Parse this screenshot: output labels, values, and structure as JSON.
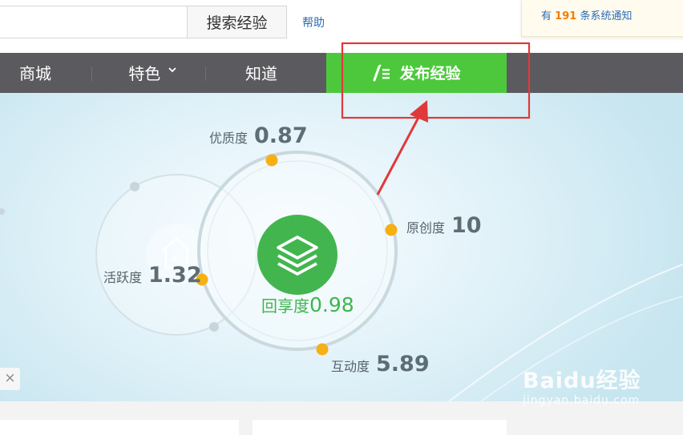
{
  "topbar": {
    "search_value": "",
    "search_button": "搜索经验",
    "help": "帮助",
    "notice_prefix": "有",
    "notice_count": "191",
    "notice_suffix": "条系统通知"
  },
  "nav": {
    "items": [
      "商城",
      "特色",
      "知道"
    ],
    "publish": "发布经验"
  },
  "metrics": {
    "quality": {
      "label": "优质度",
      "value": "0.87"
    },
    "originality": {
      "label": "原创度",
      "value": "10"
    },
    "activity": {
      "label": "活跃度",
      "value": "1.32"
    },
    "return": {
      "label": "回享度",
      "value": "0.98"
    },
    "interaction": {
      "label": "互动度",
      "value": "5.89"
    }
  },
  "close_icon": "×",
  "watermark": {
    "line1": "Baidu经验",
    "line2": "jingyan.baidu.com"
  },
  "colors": {
    "nav_bg": "#5b5b5f",
    "publish_green": "#4dc83d",
    "center_green": "#43b54f",
    "dot_orange": "#f5b014",
    "highlight_red": "#e0393a",
    "link_blue": "#2d6bb6",
    "notice_orange": "#f57c00"
  }
}
